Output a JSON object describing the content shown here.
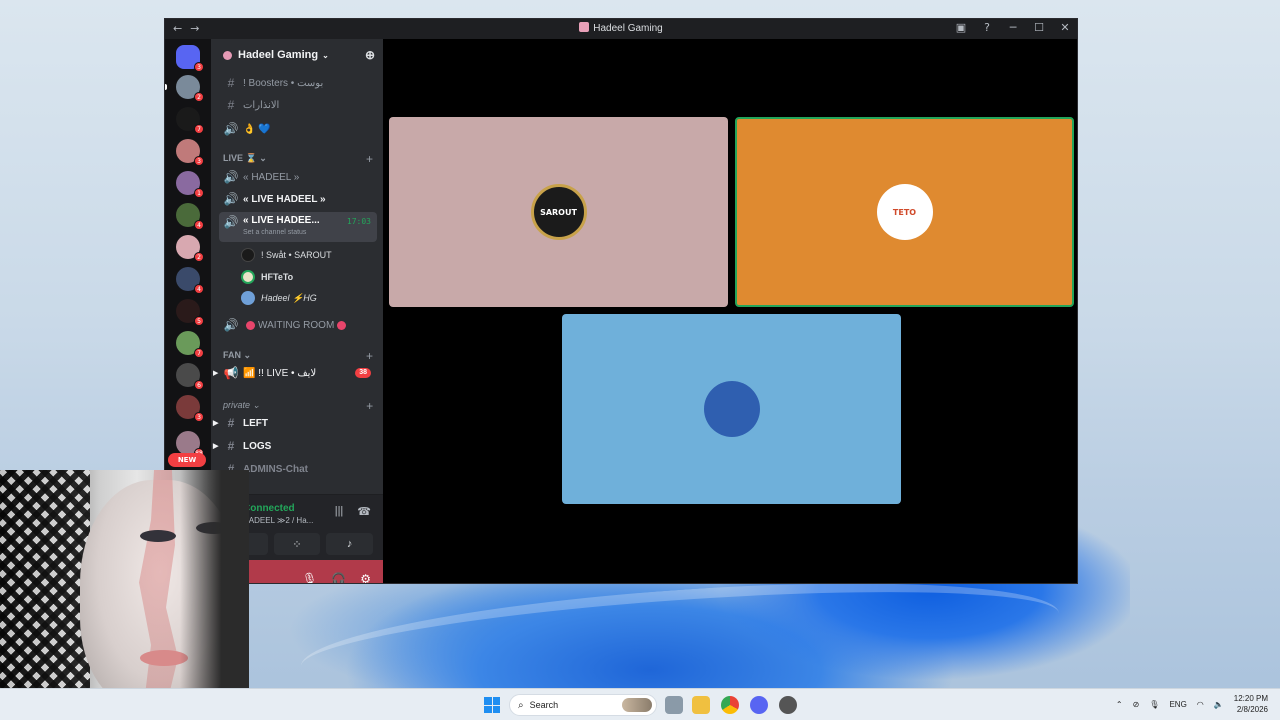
{
  "window": {
    "title": "Hadeel Gaming"
  },
  "server": {
    "name": "Hadeel Gaming"
  },
  "guild_badges": [
    "3",
    "2",
    "7",
    "3",
    "1",
    "4",
    "2",
    "4",
    "5",
    "7",
    "6",
    "3",
    "88"
  ],
  "channels_top": [
    {
      "icon": "#",
      "label": "! Boosters • بوست"
    },
    {
      "icon": "#",
      "label": "الانذارات"
    },
    {
      "icon": "🔊",
      "label": "👌 💙"
    }
  ],
  "categories": {
    "live": "LIVE ⌛",
    "fan": "FAN",
    "private": "private"
  },
  "live_channels": [
    {
      "label": "« HADEEL »"
    },
    {
      "label": "« LIVE HADEEL »"
    },
    {
      "label": "« LIVE HADEE...",
      "time": "17:03",
      "status": "Set a channel status"
    }
  ],
  "voice_users": [
    "! Swåt • SAROUT",
    "HFTeTo",
    "Hadeel ⚡HG"
  ],
  "waiting_room": "WAITING ROOM",
  "fan_channel": {
    "label": "📶 !! LIVE • لايف",
    "unread": "38"
  },
  "private_channels": [
    "LEFT",
    "LOGS",
    "ADMINS-Chat"
  ],
  "voice_panel": {
    "status": "Connected",
    "channel": "HADEEL ≫2 / Ha..."
  },
  "new_badge": "NEW",
  "tiles": [
    {
      "label": "SAROUT",
      "color": "#c8a9a9"
    },
    {
      "label": "TETO",
      "color": "#df8a30"
    },
    {
      "label": "",
      "color": "#6fb0da"
    }
  ],
  "taskbar": {
    "search": "Search",
    "lang": "ENG",
    "time": "12:20 PM",
    "date": "2/8/2026"
  }
}
